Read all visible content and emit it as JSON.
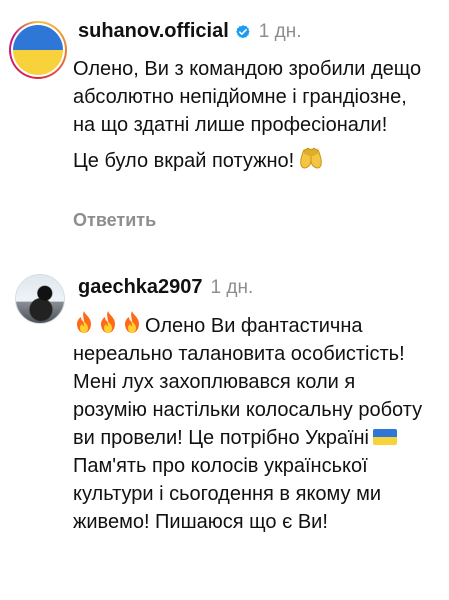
{
  "comments": [
    {
      "username": "suhanov.official",
      "time": "1 дн.",
      "paragraph1": "Олено, Ви з командою зробили дещо абсолютно непідйомне і грандіозне, на що здатні лише професіонали!",
      "paragraph2": "Це було вкрай потужно!",
      "reply_label": "Ответить",
      "avatar_icon": "ukraine-flag-avatar",
      "verified_icon": "verified-badge-icon",
      "trailing_emoji": "raised-hands-emoji"
    },
    {
      "username": "gaechka2907",
      "time": "1 дн.",
      "text_before_flag": "Олено Ви фантастична нереально талановита особистість! Мені лух захоплювався коли я розумію настільки колосальну роботу ви провели! Це потрібно Україні",
      "text_after_flag": "Пам'ять про колосів української культури і сьогодення в якому ми живемо! Пишаюся що є Ви!",
      "leading_emojis": [
        "fire-emoji",
        "fire-emoji",
        "fire-emoji"
      ],
      "inline_flag": "ukraine-flag-emoji",
      "avatar_icon": "profile-photo-avatar"
    }
  ],
  "colors": {
    "text": "#111111",
    "meta": "#8e8e8e",
    "verified": "#1d9bf0",
    "flag_blue": "#2f77d6",
    "flag_yellow": "#f7d23b"
  }
}
